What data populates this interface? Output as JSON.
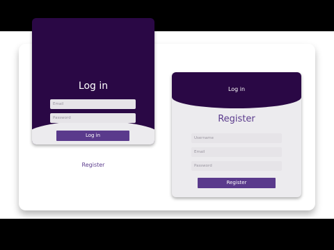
{
  "login_card": {
    "title": "Log in",
    "email_placeholder": "Email",
    "password_placeholder": "Password",
    "submit_label": "Log in",
    "switch_label": "Register"
  },
  "register_card": {
    "switch_label": "Log in",
    "title": "Register",
    "username_placeholder": "Username",
    "email_placeholder": "Email",
    "password_placeholder": "Password",
    "submit_label": "Register"
  },
  "colors": {
    "primary_dark": "#2a0845",
    "accent": "#5a3a8c",
    "field_bg": "#e6e4e8",
    "card_bg": "#ecebee"
  }
}
